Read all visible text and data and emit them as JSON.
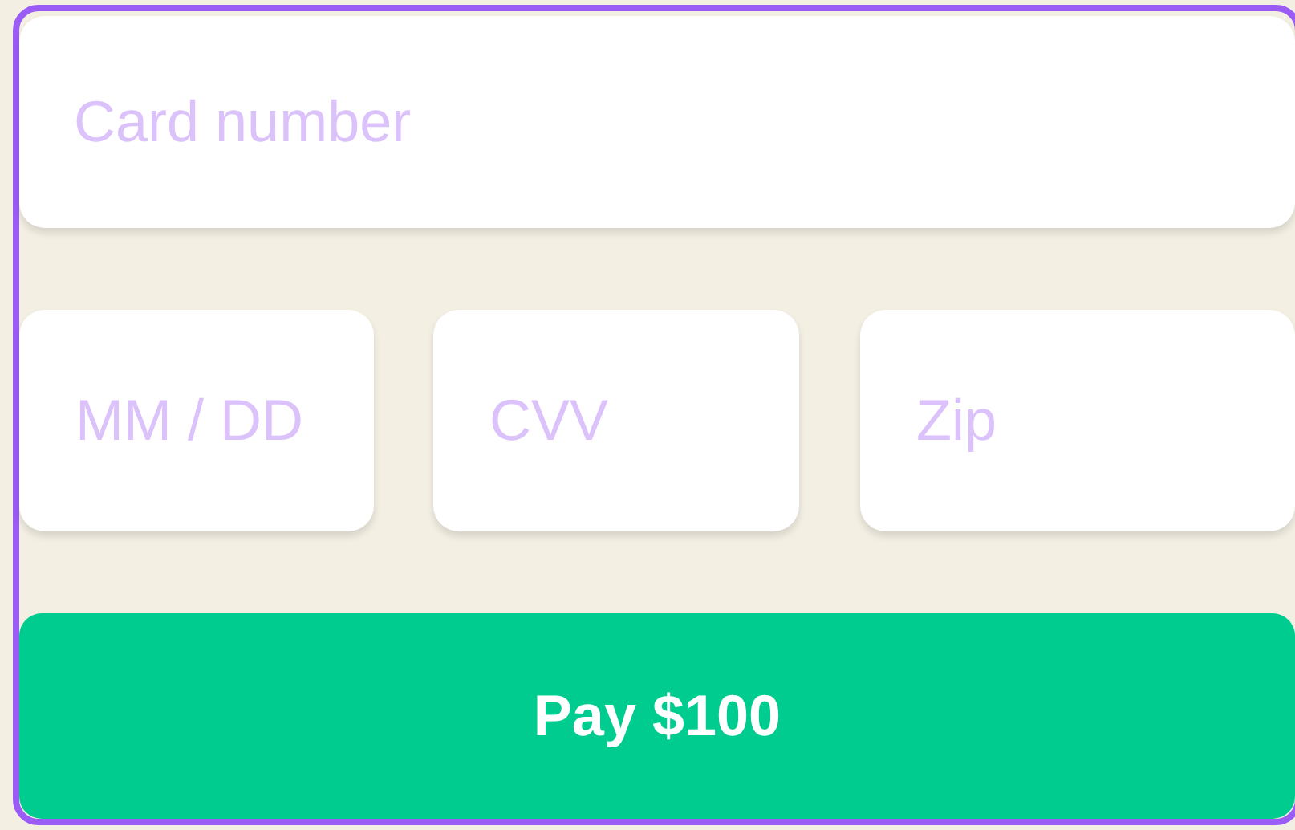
{
  "card_number": {
    "placeholder": "Card number"
  },
  "details": [
    {
      "placeholder": "MM / DD"
    },
    {
      "placeholder": "CVV"
    },
    {
      "placeholder": "Zip"
    }
  ],
  "pay_button": {
    "label": "Pay $100"
  }
}
